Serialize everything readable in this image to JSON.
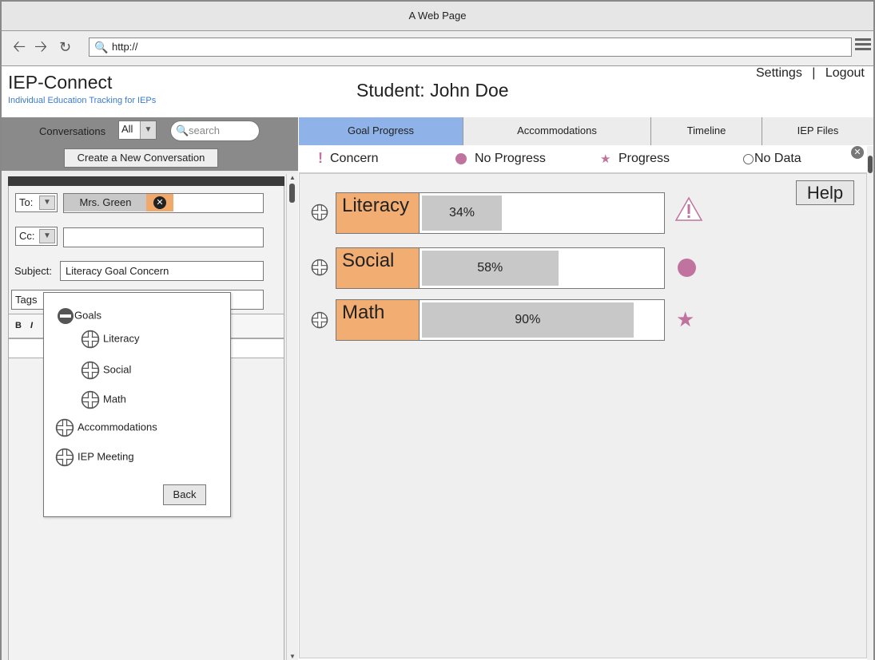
{
  "browser": {
    "window_title": "A Web Page",
    "url": "http://"
  },
  "header": {
    "app_title": "IEP-Connect",
    "app_subtitle": "Individual Education Tracking for IEPs",
    "student": "Student: John Doe",
    "settings": "Settings",
    "separator": "|",
    "logout": "Logout"
  },
  "conversations": {
    "label": "Conversations",
    "filter_value": "All",
    "search_placeholder": "search",
    "create_button": "Create a New Conversation"
  },
  "compose": {
    "to_label": "To:",
    "to_recipient": "Mrs. Green",
    "cc_label": "Cc:",
    "subject_label": "Subject:",
    "subject_value": "Literacy Goal Concern",
    "tags_label": "Tags",
    "toolbar": [
      "B",
      "I"
    ]
  },
  "tag_popup": {
    "root": "Goals",
    "children": [
      "Literacy",
      "Social",
      "Math"
    ],
    "others": [
      "Accommodations",
      "IEP Meeting"
    ],
    "back_button": "Back"
  },
  "tabs": [
    {
      "label": "Goal Progress",
      "active": true
    },
    {
      "label": "Accommodations",
      "active": false
    },
    {
      "label": "Timeline",
      "active": false
    },
    {
      "label": "IEP Files",
      "active": false
    }
  ],
  "legend": {
    "concern": "Concern",
    "no_progress": "No Progress",
    "progress": "Progress",
    "no_data": "No Data",
    "concern_icon": "exclamation-icon",
    "no_progress_icon": "circle-icon",
    "progress_icon": "star-icon",
    "no_data_icon": "empty-circle-icon"
  },
  "help_button": "Help",
  "goals": [
    {
      "name": "Literacy",
      "percent": 34,
      "percent_label": "34%",
      "status": "Concern"
    },
    {
      "name": "Social",
      "percent": 58,
      "percent_label": "58%",
      "status": "No Progress"
    },
    {
      "name": "Math",
      "percent": 90,
      "percent_label": "90%",
      "status": "Progress"
    }
  ],
  "colors": {
    "goal_label_bg": "#f2ad73",
    "active_tab": "#8fb2e8",
    "status_mark": "#c0739e",
    "progress_fill": "#c8c8c8"
  }
}
